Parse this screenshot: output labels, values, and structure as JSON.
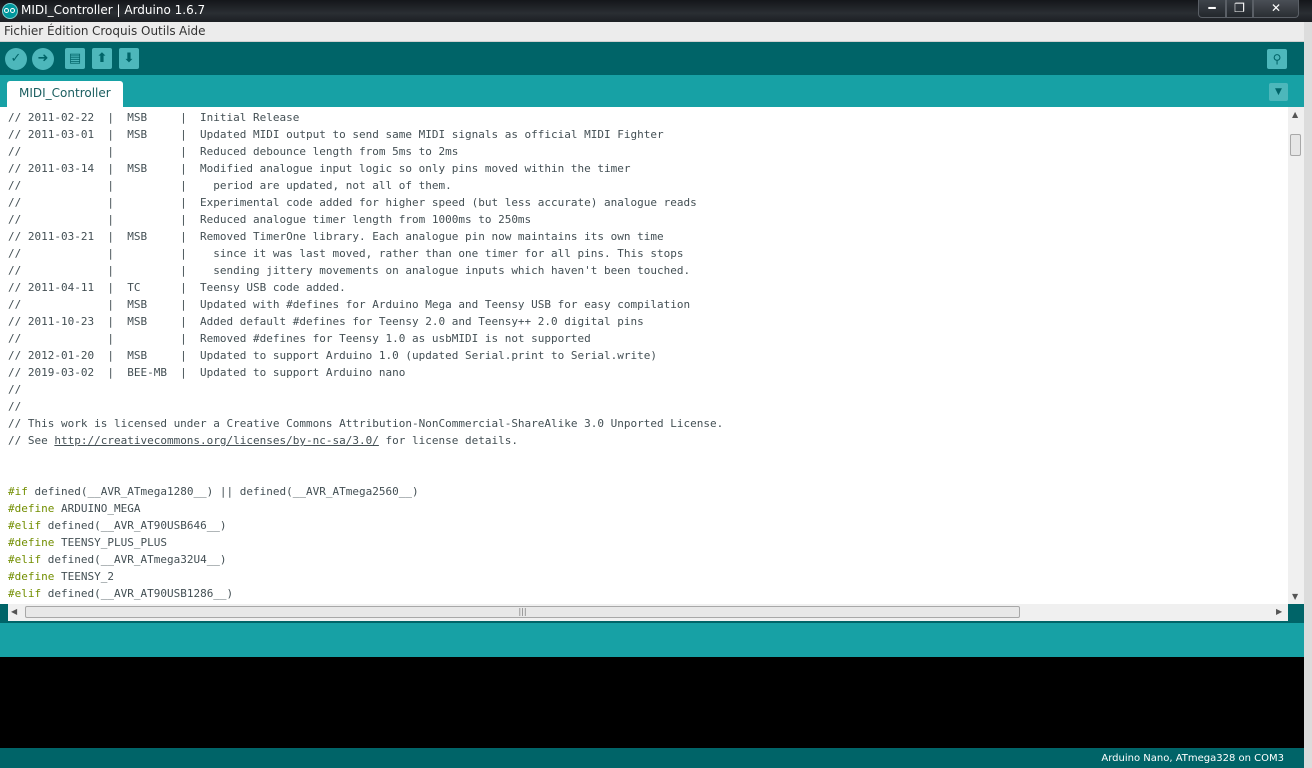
{
  "window": {
    "title": "MIDI_Controller | Arduino 1.6.7",
    "minimize": "━",
    "maximize": "❐",
    "close": "✕"
  },
  "menu": [
    "Fichier",
    "Édition",
    "Croquis",
    "Outils",
    "Aide"
  ],
  "toolbar": {
    "verify": "✓",
    "upload": "➜",
    "new": "▤",
    "open": "⬆",
    "save": "⬇",
    "serial_monitor": "⚲"
  },
  "tab": {
    "label": "MIDI_Controller",
    "menu_icon": "▼"
  },
  "code_lines": [
    [
      {
        "t": "// 2011-02-22  |  MSB     |  Initial Release"
      }
    ],
    [
      {
        "t": "// 2011-03-01  |  MSB     |  Updated MIDI output to send same MIDI signals as official MIDI Fighter"
      }
    ],
    [
      {
        "t": "//             |          |  Reduced debounce length from 5ms to 2ms"
      }
    ],
    [
      {
        "t": "// 2011-03-14  |  MSB     |  Modified analogue input logic so only pins moved within the timer"
      }
    ],
    [
      {
        "t": "//             |          |    period are updated, not all of them."
      }
    ],
    [
      {
        "t": "//             |          |  Experimental code added for higher speed (but less accurate) analogue reads"
      }
    ],
    [
      {
        "t": "//             |          |  Reduced analogue timer length from 1000ms to 250ms"
      }
    ],
    [
      {
        "t": "// 2011-03-21  |  MSB     |  Removed TimerOne library. Each analogue pin now maintains its own time"
      }
    ],
    [
      {
        "t": "//             |          |    since it was last moved, rather than one timer for all pins. This stops"
      }
    ],
    [
      {
        "t": "//             |          |    sending jittery movements on analogue inputs which haven't been touched."
      }
    ],
    [
      {
        "t": "// 2011-04-11  |  TC      |  Teensy USB code added."
      }
    ],
    [
      {
        "t": "//             |  MSB     |  Updated with #defines for Arduino Mega and Teensy USB for easy compilation"
      }
    ],
    [
      {
        "t": "// 2011-10-23  |  MSB     |  Added default #defines for Teensy 2.0 and Teensy++ 2.0 digital pins"
      }
    ],
    [
      {
        "t": "//             |          |  Removed #defines for Teensy 1.0 as usbMIDI is not supported"
      }
    ],
    [
      {
        "t": "// 2012-01-20  |  MSB     |  Updated to support Arduino 1.0 (updated Serial.print to Serial.write)"
      }
    ],
    [
      {
        "t": "// 2019-03-02  |  BEE-MB  |  Updated to support Arduino nano"
      }
    ],
    [
      {
        "t": "//"
      }
    ],
    [
      {
        "t": "//"
      }
    ],
    [
      {
        "t": "// This work is licensed under a Creative Commons Attribution-NonCommercial-ShareAlike 3.0 Unported License."
      }
    ],
    [
      {
        "t": "// See "
      },
      {
        "t": "http://creativecommons.org/licenses/by-nc-sa/3.0/",
        "c": "lnk"
      },
      {
        "t": " for license details."
      }
    ],
    [],
    [],
    [
      {
        "t": "#if",
        "c": "kw"
      },
      {
        "t": " defined(__AVR_ATmega1280__) || defined(__AVR_ATmega2560__)"
      }
    ],
    [
      {
        "t": "#define",
        "c": "kw"
      },
      {
        "t": " ARDUINO_MEGA"
      }
    ],
    [
      {
        "t": "#elif",
        "c": "kw"
      },
      {
        "t": " defined(__AVR_AT90USB646__)"
      }
    ],
    [
      {
        "t": "#define",
        "c": "kw"
      },
      {
        "t": " TEENSY_PLUS_PLUS"
      }
    ],
    [
      {
        "t": "#elif",
        "c": "kw"
      },
      {
        "t": " defined(__AVR_ATmega32U4__)"
      }
    ],
    [
      {
        "t": "#define",
        "c": "kw"
      },
      {
        "t": " TEENSY_2"
      }
    ],
    [
      {
        "t": "#elif",
        "c": "kw"
      },
      {
        "t": " defined(__AVR_AT90USB1286__)"
      }
    ]
  ],
  "scroll": {
    "up": "▲",
    "down": "▼",
    "left": "◀",
    "right": "▶",
    "grip": "|||"
  },
  "console_text": "",
  "status": {
    "board": "Arduino Nano, ATmega328 on COM3"
  }
}
